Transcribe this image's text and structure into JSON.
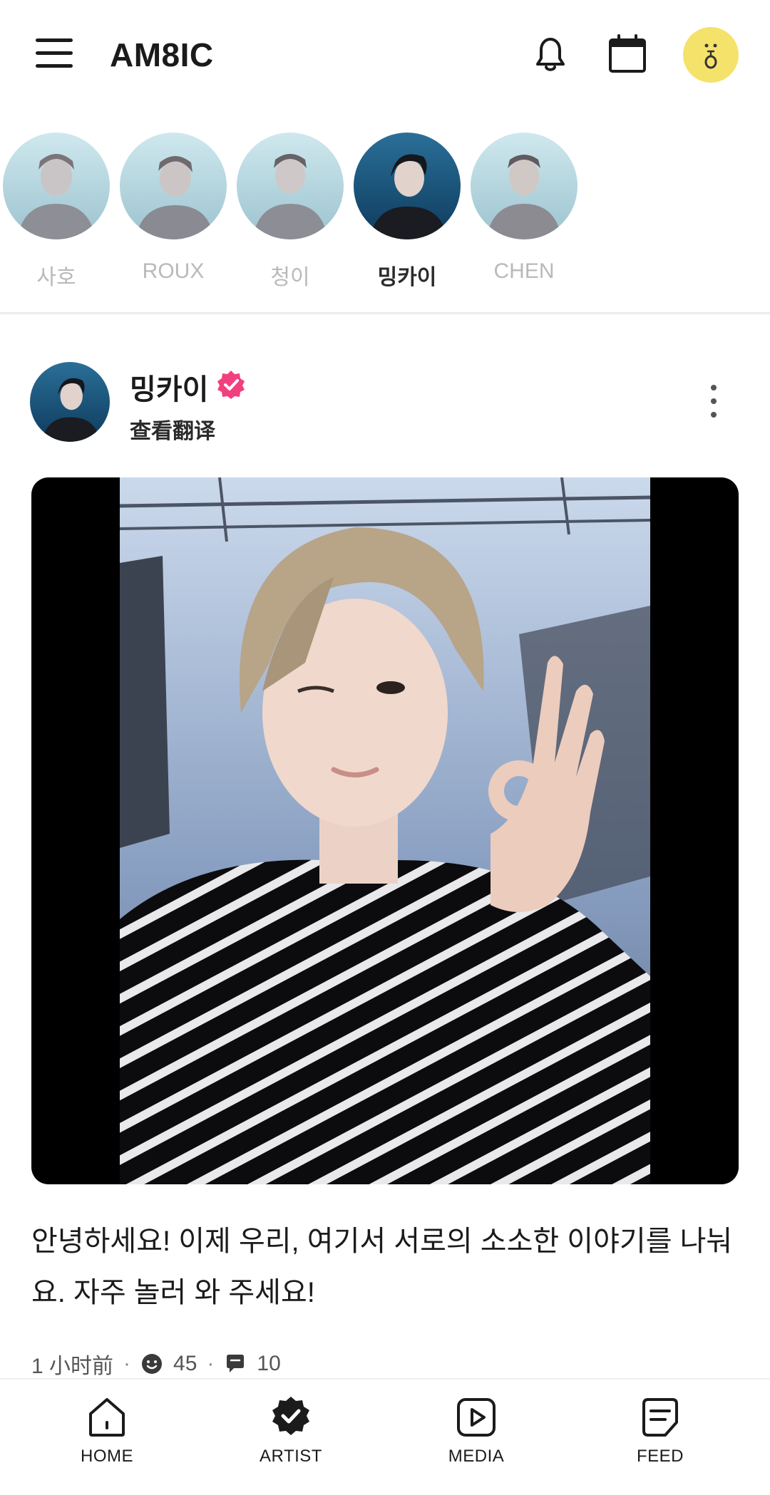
{
  "app": {
    "title": "AM8IC"
  },
  "colors": {
    "accent_yellow": "#f5e26b",
    "verified_pink": "#f23f7f"
  },
  "stories": [
    {
      "name": "사호",
      "active": false
    },
    {
      "name": "ROUX",
      "active": false
    },
    {
      "name": "청이",
      "active": false
    },
    {
      "name": "밍카이",
      "active": true
    },
    {
      "name": "CHEN",
      "active": false
    }
  ],
  "post": {
    "author": "밍카이",
    "verified": true,
    "translate_label": "查看翻译",
    "text": "안녕하세요! 이제 우리, 여기서 서로의 소소한 이야기를 나눠요. 자주 놀러 와 주세요!",
    "time": "1 小时前",
    "reactions": "45",
    "comments": "10"
  },
  "tabs": [
    {
      "label": "HOME",
      "icon": "home-icon"
    },
    {
      "label": "ARTIST",
      "icon": "artist-badge-icon"
    },
    {
      "label": "MEDIA",
      "icon": "play-icon"
    },
    {
      "label": "FEED",
      "icon": "feed-icon"
    }
  ]
}
